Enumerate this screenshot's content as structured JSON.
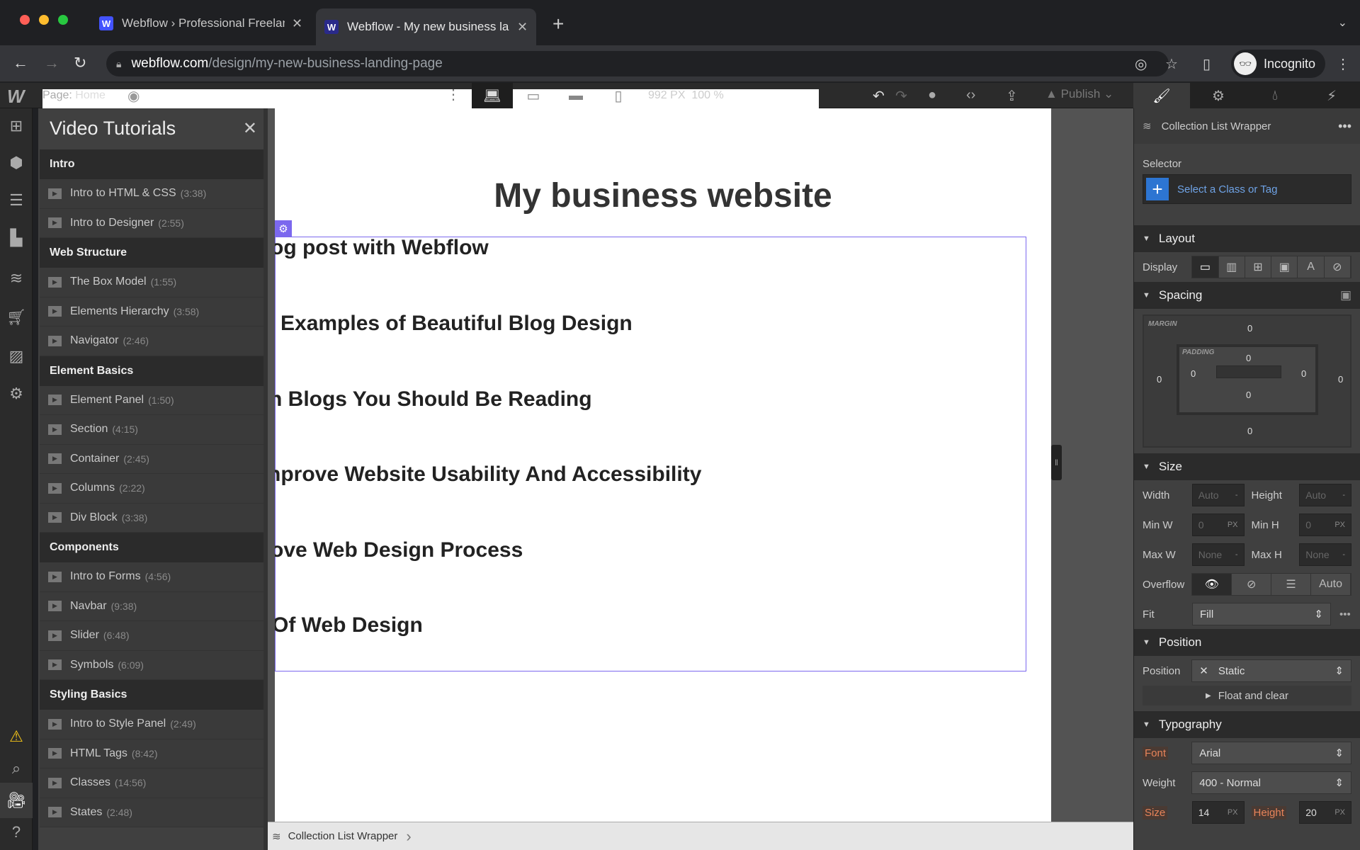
{
  "browser": {
    "tabs": [
      {
        "title": "Webflow › Professional Freelan",
        "active": false
      },
      {
        "title": "Webflow - My new business la",
        "active": true
      }
    ],
    "url_host": "webflow.com",
    "url_path": "/design/my-new-business-landing-page",
    "profile_label": "Incognito"
  },
  "topbar": {
    "page_prefix": "Page:",
    "page_name": "Home",
    "width_readout": "992 PX",
    "zoom_readout": "100 %",
    "publish_label": "Publish"
  },
  "tutorials": {
    "title": "Video Tutorials",
    "sections": [
      {
        "name": "Intro",
        "items": [
          {
            "label": "Intro to HTML & CSS",
            "duration": "(3:38)"
          },
          {
            "label": "Intro to Designer",
            "duration": "(2:55)"
          }
        ]
      },
      {
        "name": "Web Structure",
        "items": [
          {
            "label": "The Box Model",
            "duration": "(1:55)"
          },
          {
            "label": "Elements Hierarchy",
            "duration": "(3:58)"
          },
          {
            "label": "Navigator",
            "duration": "(2:46)"
          }
        ]
      },
      {
        "name": "Element Basics",
        "items": [
          {
            "label": "Element Panel",
            "duration": "(1:50)"
          },
          {
            "label": "Section",
            "duration": "(4:15)"
          },
          {
            "label": "Container",
            "duration": "(2:45)"
          },
          {
            "label": "Columns",
            "duration": "(2:22)"
          },
          {
            "label": "Div Block",
            "duration": "(3:38)"
          }
        ]
      },
      {
        "name": "Components",
        "items": [
          {
            "label": "Intro to Forms",
            "duration": "(4:56)"
          },
          {
            "label": "Navbar",
            "duration": "(9:38)"
          },
          {
            "label": "Slider",
            "duration": "(6:48)"
          },
          {
            "label": "Symbols",
            "duration": "(6:09)"
          }
        ]
      },
      {
        "name": "Styling Basics",
        "items": [
          {
            "label": "Intro to Style Panel",
            "duration": "(2:49)"
          },
          {
            "label": "HTML Tags",
            "duration": "(8:42)"
          },
          {
            "label": "Classes",
            "duration": "(14:56)"
          },
          {
            "label": "States",
            "duration": "(2:48)"
          }
        ]
      }
    ]
  },
  "canvas": {
    "heading": "My business website",
    "posts": [
      "og post with Webflow",
      "Examples of Beautiful Blog Design",
      "n Blogs You Should Be Reading",
      "nprove Website Usability And Accessibility",
      "ove Web Design Process",
      "Of Web Design"
    ],
    "selection_color": "#7b68ee",
    "breadcrumb": "Collection List Wrapper"
  },
  "style_panel": {
    "element_name": "Collection List Wrapper",
    "selector_label": "Selector",
    "selector_placeholder": "Select a Class or Tag",
    "layout": {
      "title": "Layout",
      "display_label": "Display"
    },
    "spacing": {
      "title": "Spacing",
      "margin_label": "MARGIN",
      "padding_label": "PADDING",
      "margin": {
        "top": "0",
        "right": "0",
        "bottom": "0",
        "left": "0"
      },
      "padding": {
        "top": "0",
        "right": "0",
        "bottom": "0",
        "left": "0"
      }
    },
    "size": {
      "title": "Size",
      "width_label": "Width",
      "width": "Auto",
      "height_label": "Height",
      "height": "Auto",
      "min_w_label": "Min W",
      "min_w": "0",
      "min_h_label": "Min H",
      "min_h": "0",
      "max_w_label": "Max W",
      "max_w": "None",
      "max_h_label": "Max H",
      "max_h": "None",
      "unit_px": "PX",
      "unit_dash": "-",
      "overflow_label": "Overflow",
      "overflow_auto": "Auto",
      "fit_label": "Fit",
      "fit": "Fill"
    },
    "position": {
      "title": "Position",
      "label": "Position",
      "value": "Static",
      "float_label": "Float and clear"
    },
    "typography": {
      "title": "Typography",
      "font_label": "Font",
      "font": "Arial",
      "weight_label": "Weight",
      "weight": "400 - Normal",
      "size_label": "Size",
      "size": "14",
      "height_label": "Height",
      "height": "20",
      "unit": "PX"
    }
  }
}
